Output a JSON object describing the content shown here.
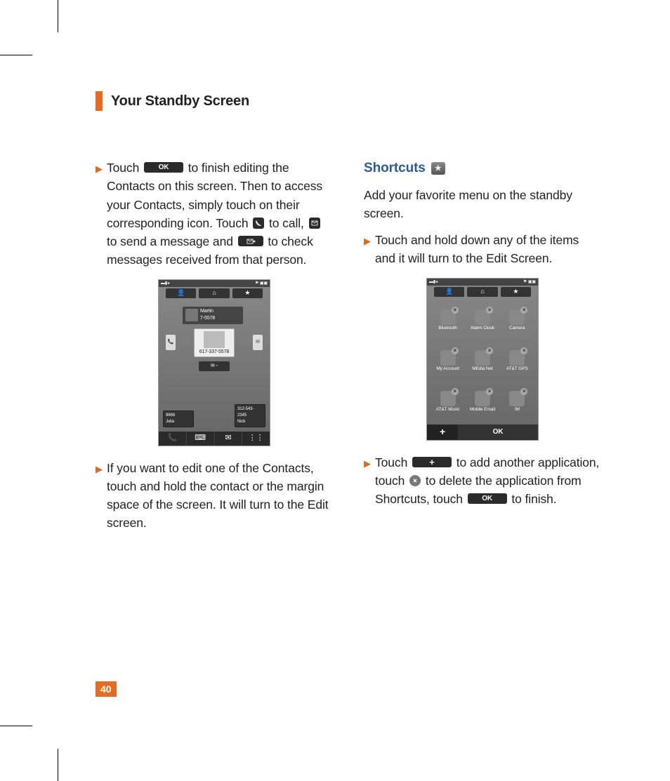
{
  "header": {
    "title": "Your Standby Screen"
  },
  "page_number": "40",
  "left": {
    "p1_a": "Touch ",
    "p1_b": " to finish editing the Contacts on this screen. Then to access your Contacts, simply touch on their corresponding icon. Touch ",
    "p1_c": " to call, ",
    "p1_d": " to send a message and ",
    "p1_e": " to check messages received from that person.",
    "p2": "If you want to edit one of the Contacts, touch and hold the contact or the margin space of the screen. It will turn to the Edit screen.",
    "ok_label": "OK",
    "screen": {
      "status_left": "▬▮◂",
      "status_right": "⚑ ▣▣",
      "tab_contact": "👤",
      "tab_home": "⌂",
      "tab_star": "★",
      "contact_top_name": "Martin",
      "contact_top_num": "7-5578",
      "card_num": "617-337-5578",
      "side_call": "📞",
      "side_msg": "✉",
      "mid_icon": "✉ ◦",
      "mini_left_num": "9868",
      "mini_left_name": "Julia",
      "mini_right_num": "312-543-2345",
      "mini_right_name": "Nick",
      "bb_call": "📞",
      "bb_dial": "⌨",
      "bb_msg": "✉",
      "bb_menu": "⋮⋮"
    }
  },
  "right": {
    "heading": "Shortcuts",
    "intro": "Add your favorite menu on the standby screen.",
    "p1": "Touch and hold down any of the items and it will turn to the Edit Screen.",
    "p2_a": "Touch ",
    "p2_b": " to add another application, touch ",
    "p2_c": " to delete the application from Shortcuts, touch ",
    "p2_d": " to finish.",
    "plus_label": "+",
    "ok_label": "OK",
    "screen": {
      "status_left": "▬▮◂",
      "status_right": "⚑ ▣▣",
      "tab_contact": "👤",
      "tab_home": "⌂",
      "tab_star": "★",
      "items": [
        "Bluetooth",
        "Alarm Clock",
        "Camera",
        "My Account",
        "MEdia Net",
        "AT&T GPS",
        "AT&T Music",
        "Mobile Email",
        "IM"
      ],
      "plus": "+",
      "ok": "OK"
    }
  }
}
